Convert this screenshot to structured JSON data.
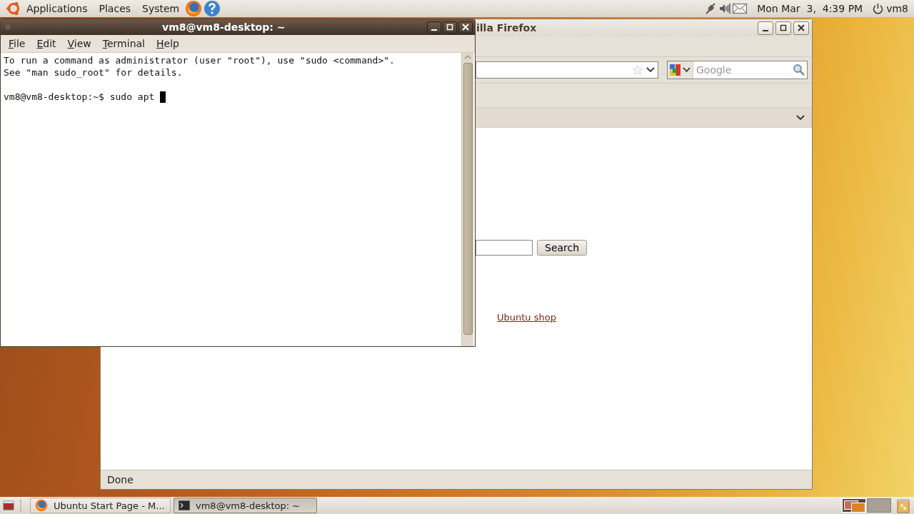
{
  "top_panel": {
    "menus": [
      "Applications",
      "Places",
      "System"
    ],
    "clock": "Mon Mar  3,  4:39 PM",
    "user": "vm8"
  },
  "firefox_window": {
    "title": "illa Firefox",
    "search_field": {
      "placeholder": "Google"
    },
    "page": {
      "search_button": "Search",
      "link": "Ubuntu shop"
    },
    "status_bar": "Done"
  },
  "terminal_window": {
    "title": "vm8@vm8-desktop: ~",
    "menus": [
      "File",
      "Edit",
      "View",
      "Terminal",
      "Help"
    ],
    "lines": [
      "To run a command as administrator (user \"root\"), use \"sudo <command>\".",
      "See \"man sudo_root\" for details."
    ],
    "prompt": "vm8@vm8-desktop:~$ sudo apt "
  },
  "taskbar": {
    "items": [
      {
        "label": "Ubuntu Start Page - M...",
        "kind": "browser",
        "selected": false
      },
      {
        "label": "vm8@vm8-desktop: ~",
        "kind": "terminal",
        "selected": true
      }
    ],
    "workspaces": [
      {
        "selected": true
      },
      {
        "selected": false
      }
    ]
  }
}
